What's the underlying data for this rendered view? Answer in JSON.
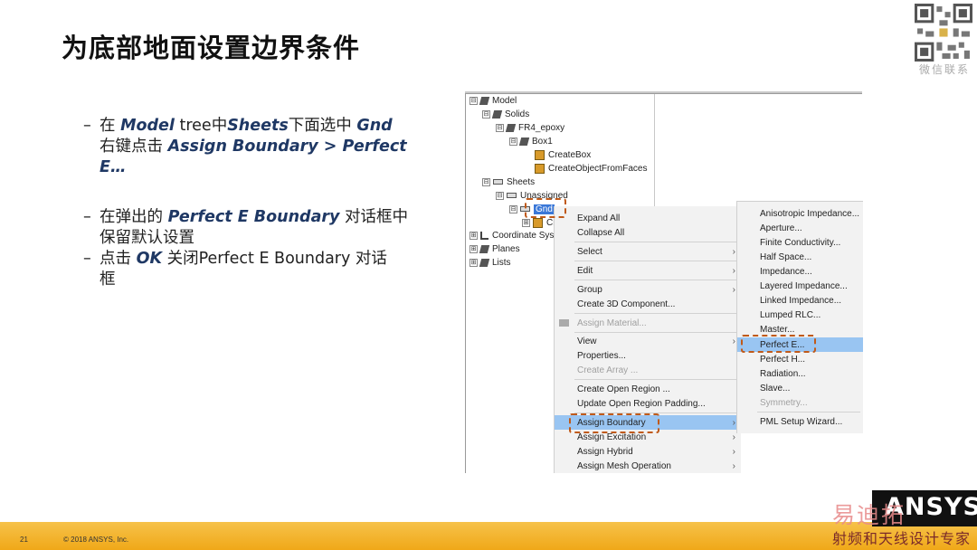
{
  "slide": {
    "title": "为底部地面设置边界条件",
    "page_number": "21",
    "copyright": "© 2018 ANSYS, Inc.",
    "qr_label": "微信联系",
    "logo_text": "ANSYS",
    "watermark_top": "易迪拓",
    "watermark_bottom": "射频和天线设计专家"
  },
  "bullets": {
    "b1_l1_a": "在 ",
    "b1_l1_em1": "Model",
    "b1_l1_b": " tree中",
    "b1_l1_em2": "Sheets",
    "b1_l1_c": "下面选中 ",
    "b1_l1_em3": "Gnd",
    "b1_l2_a": "右键点击 ",
    "b1_l2_em": "Assign Boundary > Perfect",
    "b1_l3_em": "E…",
    "b2_a": "在弹出的 ",
    "b2_em": "Perfect E Boundary",
    "b2_b": " 对话框中",
    "b2_l2": "保留默认设置",
    "b3_a": "点击 ",
    "b3_em": "OK",
    "b3_b": " 关闭Perfect E Boundary 对话",
    "b3_l2": "框"
  },
  "tree": {
    "model": "Model",
    "solids": "Solids",
    "fr4": "FR4_epoxy",
    "box1": "Box1",
    "createbox": "CreateBox",
    "createobj": "CreateObjectFromFaces",
    "sheets": "Sheets",
    "unassigned": "Unassigned",
    "gnd": "Gnd",
    "cr": "Cr",
    "coord": "Coordinate Sys",
    "planes": "Planes",
    "lists": "Lists"
  },
  "context_menu": {
    "expand_all": "Expand All",
    "collapse_all": "Collapse All",
    "select": "Select",
    "edit": "Edit",
    "group": "Group",
    "create_3d": "Create 3D Component...",
    "assign_material": "Assign Material...",
    "view": "View",
    "properties": "Properties...",
    "create_array": "Create Array ...",
    "create_open_region": "Create Open Region ...",
    "update_open_region": "Update Open Region Padding...",
    "assign_boundary": "Assign Boundary",
    "assign_excitation": "Assign Excitation",
    "assign_hybrid": "Assign Hybrid",
    "assign_mesh": "Assign Mesh Operation"
  },
  "submenu": {
    "anisotropic": "Anisotropic Impedance...",
    "aperture": "Aperture...",
    "finite": "Finite Conductivity...",
    "half_space": "Half Space...",
    "impedance": "Impedance...",
    "layered": "Layered Impedance...",
    "linked": "Linked Impedance...",
    "lumped": "Lumped RLC...",
    "master": "Master...",
    "perfect_e": "Perfect E...",
    "perfect_h": "Perfect H...",
    "radiation": "Radiation...",
    "slave": "Slave...",
    "symmetry": "Symmetry...",
    "pml": "PML Setup Wizard..."
  },
  "colors": {
    "highlight": "#99c5f2",
    "callout": "#c05a1a",
    "footer": "#f0a818",
    "emphasis": "#1f3864"
  },
  "icons": [
    "qr-code-icon",
    "model-icon",
    "solid-icon",
    "sheet-icon",
    "box-icon",
    "coordinate-icon",
    "submenu-arrow-icon"
  ]
}
